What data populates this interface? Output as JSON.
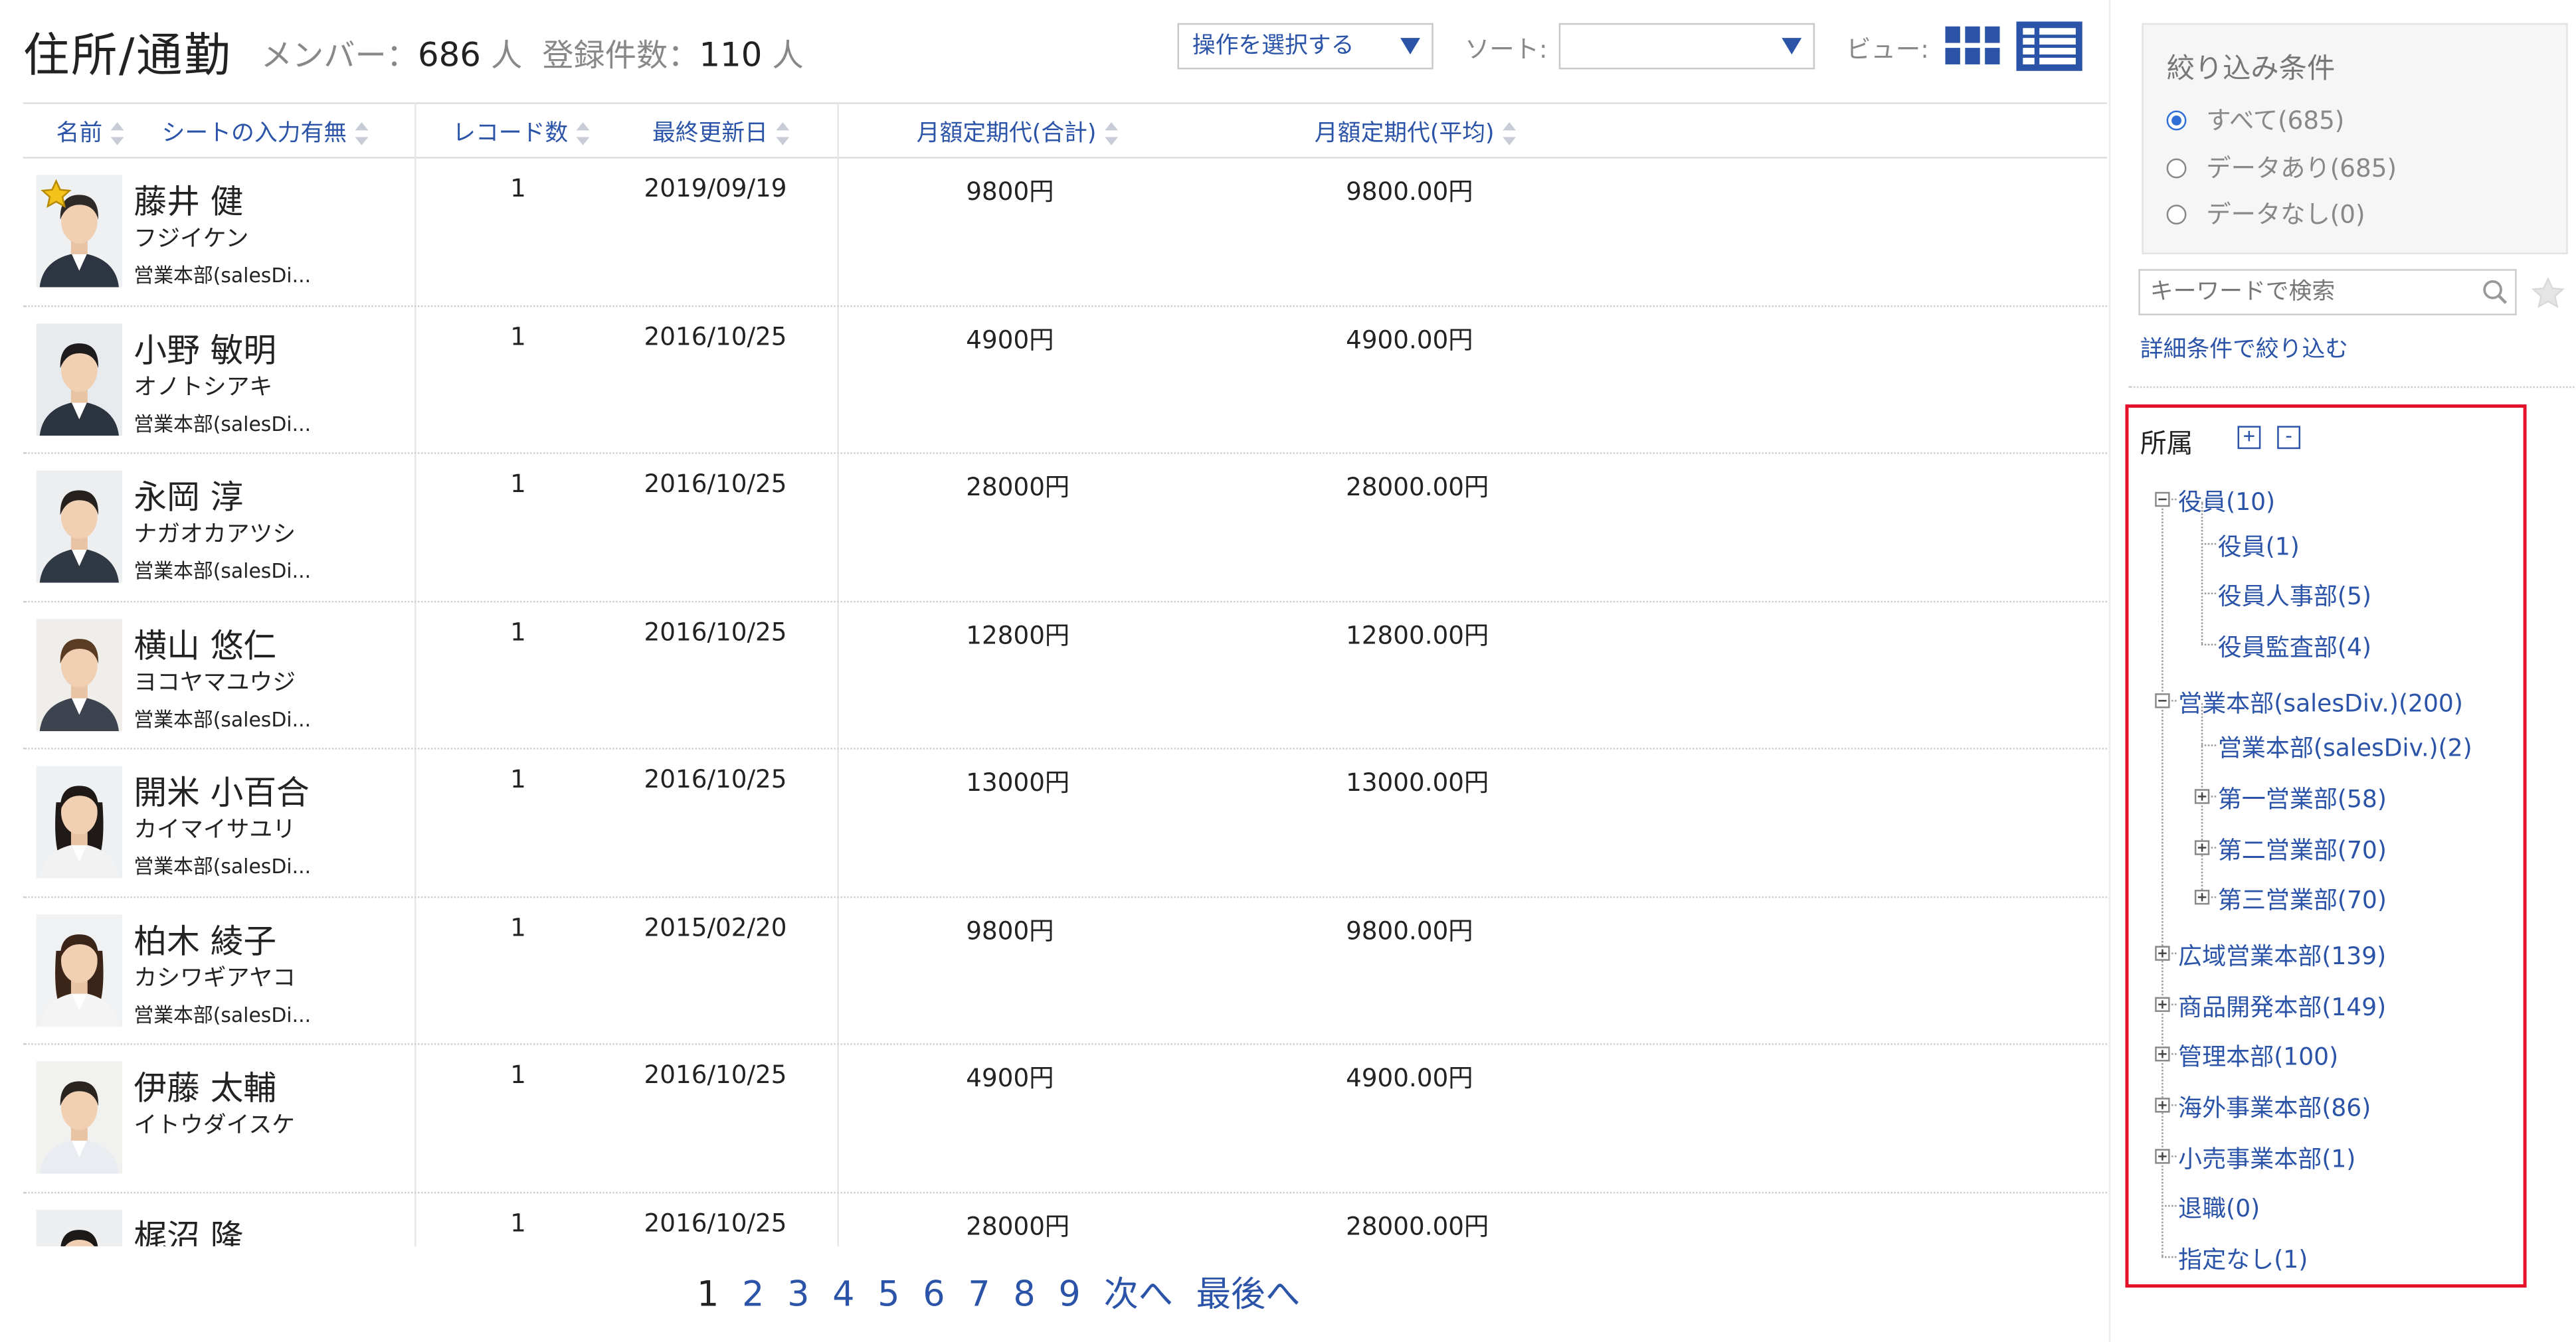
{
  "header": {
    "title": "住所/通勤",
    "member_label": "メンバー：",
    "member_count": "686",
    "registered_label": "登録件数：",
    "registered_count": "110",
    "unit": "人",
    "action_select": "操作を選択する",
    "sort_label": "ソート:",
    "sort_value": "",
    "view_label": "ビュー:"
  },
  "table": {
    "columns": [
      "名前",
      "シートの入力有無",
      "レコード数",
      "最終更新日",
      "月額定期代(合計)",
      "月額定期代(平均)"
    ],
    "rows": [
      {
        "name": "藤井 健",
        "kana": "フジイケン",
        "dept": "営業本部(salesDi...",
        "count": "1",
        "date": "2019/09/19",
        "total": "9800円",
        "avg": "9800.00円",
        "star": true
      },
      {
        "name": "小野 敏明",
        "kana": "オノトシアキ",
        "dept": "営業本部(salesDi...",
        "count": "1",
        "date": "2016/10/25",
        "total": "4900円",
        "avg": "4900.00円"
      },
      {
        "name": "永岡 淳",
        "kana": "ナガオカアツシ",
        "dept": "営業本部(salesDi...",
        "count": "1",
        "date": "2016/10/25",
        "total": "28000円",
        "avg": "28000.00円"
      },
      {
        "name": "横山 悠仁",
        "kana": "ヨコヤマユウジ",
        "dept": "営業本部(salesDi...",
        "count": "1",
        "date": "2016/10/25",
        "total": "12800円",
        "avg": "12800.00円"
      },
      {
        "name": "開米 小百合",
        "kana": "カイマイサユリ",
        "dept": "営業本部(salesDi...",
        "count": "1",
        "date": "2016/10/25",
        "total": "13000円",
        "avg": "13000.00円"
      },
      {
        "name": "柏木 綾子",
        "kana": "カシワギアヤコ",
        "dept": "営業本部(salesDi...",
        "count": "1",
        "date": "2015/02/20",
        "total": "9800円",
        "avg": "9800.00円"
      },
      {
        "name": "伊藤 太輔",
        "kana": "イトウダイスケ",
        "dept": "",
        "count": "1",
        "date": "2016/10/25",
        "total": "4900円",
        "avg": "4900.00円"
      },
      {
        "name": "梶沼 隆",
        "kana": "",
        "dept": "",
        "count": "1",
        "date": "2016/10/25",
        "total": "28000円",
        "avg": "28000.00円"
      }
    ]
  },
  "pager": {
    "pages": [
      "1",
      "2",
      "3",
      "4",
      "5",
      "6",
      "7",
      "8",
      "9"
    ],
    "current": "1",
    "next": "次へ",
    "last": "最後へ"
  },
  "filter": {
    "title": "絞り込み条件",
    "options": [
      "すべて(685)",
      "データあり(685)",
      "データなし(0)"
    ],
    "selected_index": 0,
    "keyword_placeholder": "キーワードで検索",
    "advanced": "詳細条件で絞り込む"
  },
  "tree": {
    "title": "所属",
    "expand_all": "+",
    "collapse_all": "-",
    "nodes": [
      {
        "label": "役員(10)",
        "level": 0,
        "state": "open"
      },
      {
        "label": "役員(1)",
        "level": 1,
        "state": "leaf"
      },
      {
        "label": "役員人事部(5)",
        "level": 1,
        "state": "leaf"
      },
      {
        "label": "役員監査部(4)",
        "level": 1,
        "state": "leaf"
      },
      {
        "label": "営業本部(salesDiv.)(200)",
        "level": 0,
        "state": "open"
      },
      {
        "label": "営業本部(salesDiv.)(2)",
        "level": 1,
        "state": "leaf"
      },
      {
        "label": "第一営業部(58)",
        "level": 1,
        "state": "closed"
      },
      {
        "label": "第二営業部(70)",
        "level": 1,
        "state": "closed"
      },
      {
        "label": "第三営業部(70)",
        "level": 1,
        "state": "closed"
      },
      {
        "label": "広域営業本部(139)",
        "level": 0,
        "state": "closed"
      },
      {
        "label": "商品開発本部(149)",
        "level": 0,
        "state": "closed"
      },
      {
        "label": "管理本部(100)",
        "level": 0,
        "state": "closed"
      },
      {
        "label": "海外事業本部(86)",
        "level": 0,
        "state": "closed"
      },
      {
        "label": "小売事業本部(1)",
        "level": 0,
        "state": "closed"
      },
      {
        "label": "退職(0)",
        "level": 0,
        "state": "leaf"
      },
      {
        "label": "指定なし(1)",
        "level": 0,
        "state": "leaf"
      }
    ]
  },
  "colors": {
    "link": "#2b54a8",
    "accent_red": "#e3112a",
    "radio_on": "#2f6fd6"
  },
  "icons": [
    "sort-icon",
    "grid-view-icon",
    "list-view-icon",
    "search-icon",
    "star-icon",
    "favorite-star-icon",
    "expand-icon",
    "collapse-icon"
  ]
}
